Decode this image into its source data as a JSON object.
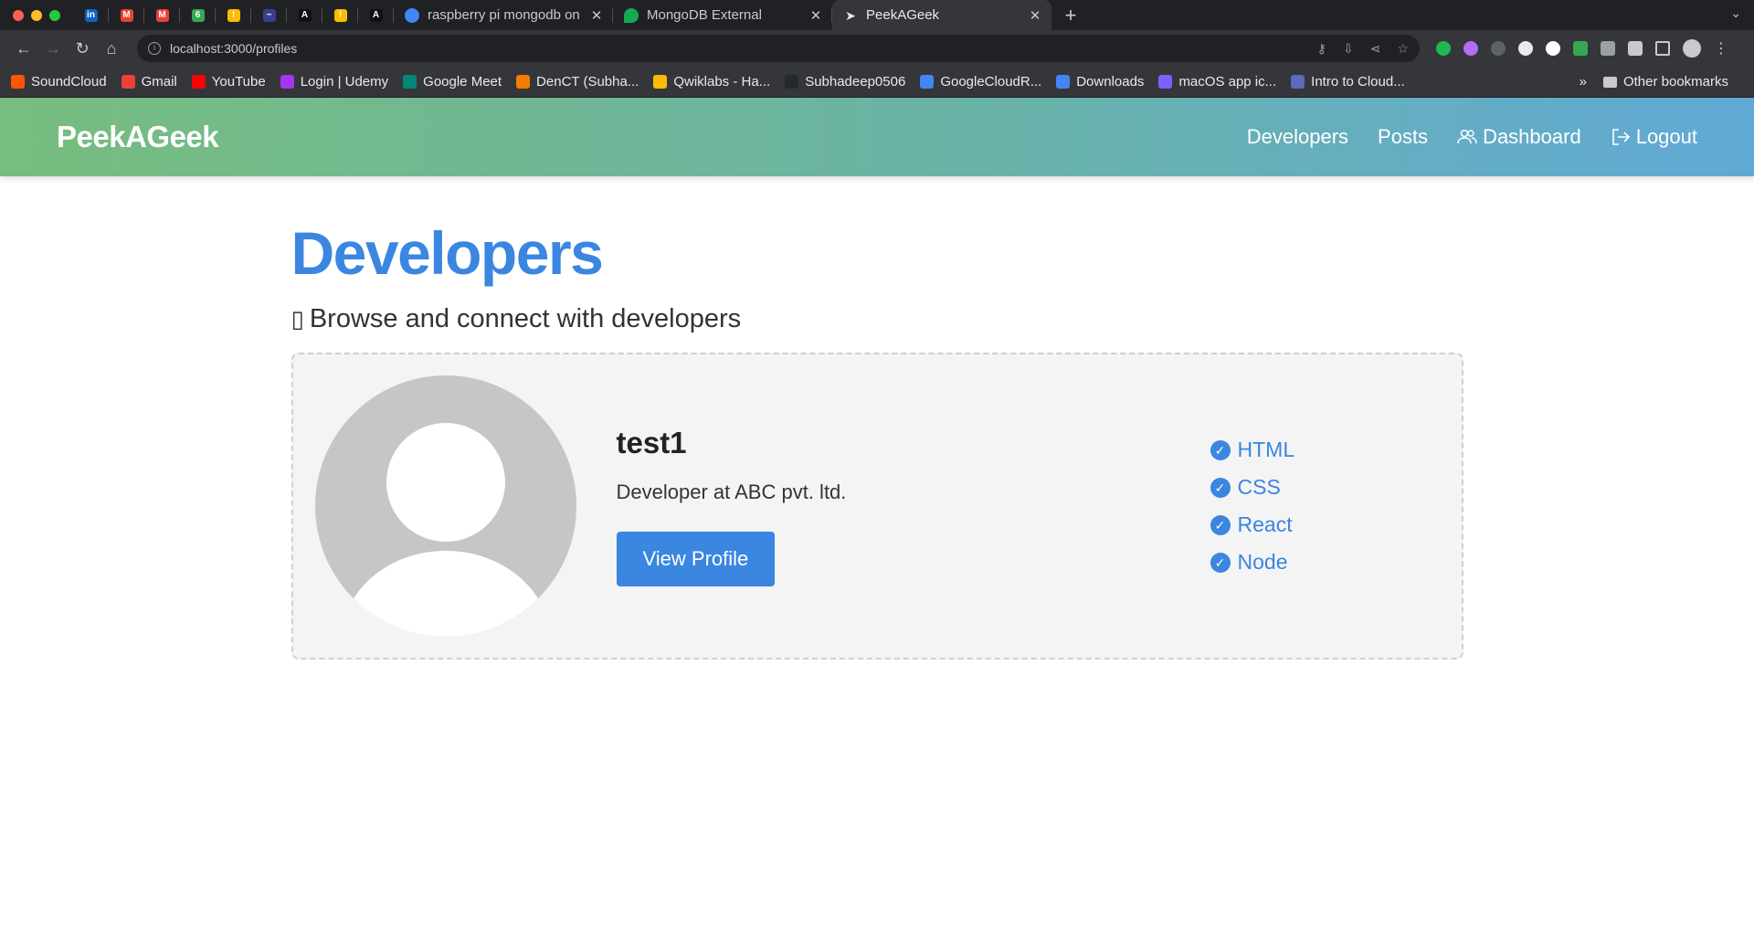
{
  "browser": {
    "colors": {
      "chrome_dark": "#202124",
      "chrome_mid": "#35363a",
      "text": "#e8eaed"
    },
    "pinned_tabs": [
      {
        "name": "linkedin",
        "color": "#0a66c2",
        "glyph": "in"
      },
      {
        "name": "gmail-1",
        "color": "#ea4335",
        "glyph": "M"
      },
      {
        "name": "gmail-2",
        "color": "#ea4335",
        "glyph": "M"
      },
      {
        "name": "leaf",
        "color": "#34a853",
        "glyph": "6"
      },
      {
        "name": "key",
        "color": "#fbbc04",
        "glyph": "!"
      },
      {
        "name": "terminal",
        "color": "#3b3f8f",
        "glyph": "~"
      },
      {
        "name": "notion-a",
        "color": "#111111",
        "glyph": "A"
      },
      {
        "name": "bell",
        "color": "#fbbc04",
        "glyph": "!"
      },
      {
        "name": "notion-b",
        "color": "#111111",
        "glyph": "A"
      }
    ],
    "tabs": [
      {
        "title": "raspberry pi mongodb on",
        "favicon_color": "#4285f4",
        "active": false
      },
      {
        "title": "MongoDB External",
        "favicon_color": "#13aa52",
        "active": false
      },
      {
        "title": "PeekAGeek",
        "favicon_color": "#e8eaed",
        "active": true
      }
    ],
    "address": {
      "url": "localhost:3000/profiles"
    },
    "bookmarks": [
      {
        "label": "SoundCloud",
        "color": "#ff5500"
      },
      {
        "label": "Gmail",
        "color": "#ea4335"
      },
      {
        "label": "YouTube",
        "color": "#ff0000"
      },
      {
        "label": "Login | Udemy",
        "color": "#a435f0"
      },
      {
        "label": "Google Meet",
        "color": "#00897b"
      },
      {
        "label": "DenCT (Subha...",
        "color": "#f57c00"
      },
      {
        "label": "Qwiklabs - Ha...",
        "color": "#fbbc04"
      },
      {
        "label": "Subhadeep0506",
        "color": "#24292e"
      },
      {
        "label": "GoogleCloudR...",
        "color": "#4285f4"
      },
      {
        "label": "Downloads",
        "color": "#4285f4"
      },
      {
        "label": "macOS app ic...",
        "color": "#7b61ff"
      },
      {
        "label": "Intro to Cloud...",
        "color": "#5c6bc0"
      }
    ],
    "bookmarks_overflow": "»",
    "other_bookmarks": "Other bookmarks"
  },
  "site": {
    "brand": "PeekAGeek",
    "nav": {
      "developers": "Developers",
      "posts": "Posts",
      "dashboard": "Dashboard",
      "logout": "Logout"
    },
    "accent": "#3a86e0"
  },
  "main": {
    "title": "Developers",
    "lead_glyph": "▯",
    "lead": "Browse and connect with developers",
    "profiles": [
      {
        "name": "test1",
        "role": "Developer at ABC pvt. ltd.",
        "button": "View Profile",
        "skills": [
          "HTML",
          "CSS",
          "React",
          "Node"
        ]
      }
    ]
  }
}
